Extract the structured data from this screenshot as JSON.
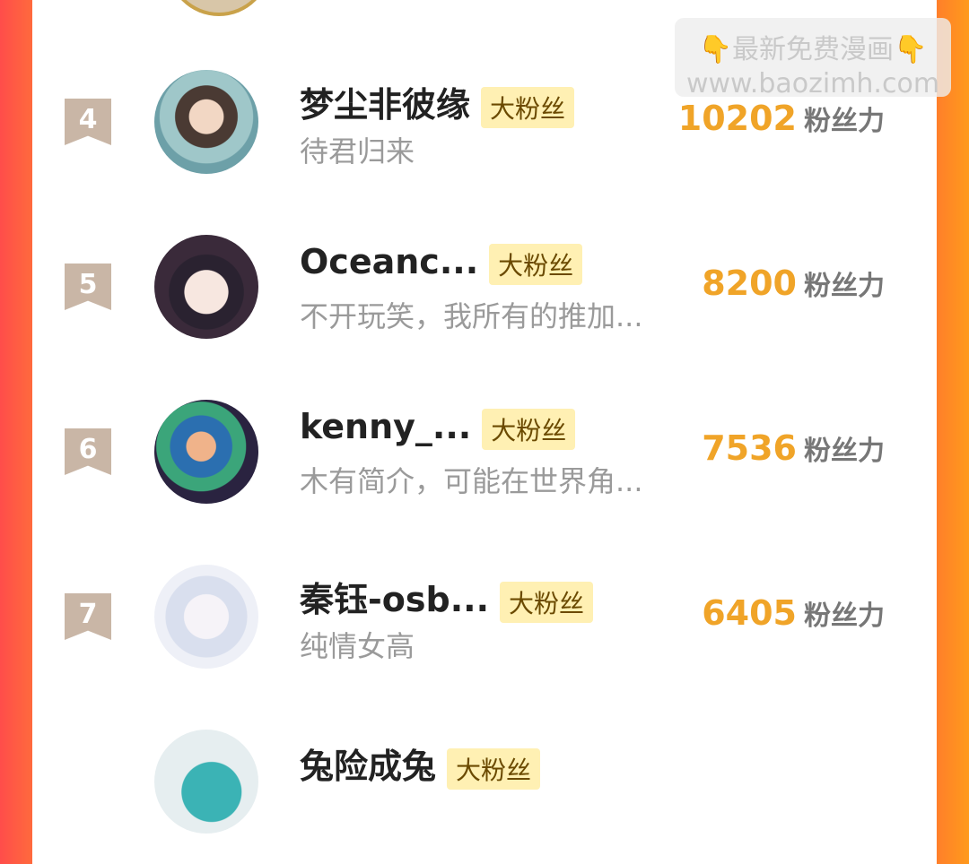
{
  "watermark": {
    "line1": "最新免费漫画",
    "line2": "www.baozimh.com",
    "icon": "pointing-down-hand"
  },
  "rows": [
    {
      "rank": "4",
      "name": "梦尘非彼缘",
      "badge": "大粉丝",
      "bio": "待君归来",
      "score": "10202",
      "unit": "粉丝力"
    },
    {
      "rank": "5",
      "name": "Oceanc...",
      "badge": "大粉丝",
      "bio": "不开玩笑，我所有的推加...",
      "score": "8200",
      "unit": "粉丝力"
    },
    {
      "rank": "6",
      "name": "kenny_...",
      "badge": "大粉丝",
      "bio": "木有简介，可能在世界角...",
      "score": "7536",
      "unit": "粉丝力"
    },
    {
      "rank": "7",
      "name": "秦钰-osb...",
      "badge": "大粉丝",
      "bio": "纯情女高",
      "score": "6405",
      "unit": "粉丝力"
    },
    {
      "rank": "",
      "name": "兔险成兔",
      "badge": "大粉丝",
      "bio": "",
      "score": "",
      "unit": ""
    }
  ],
  "colors": {
    "accent_score": "#f0a428",
    "rank_bg": "#c9b6a6",
    "badge_bg": "#fff0b3",
    "left_edge": "#ff4d4a",
    "right_edge": "#ff9a1c"
  }
}
